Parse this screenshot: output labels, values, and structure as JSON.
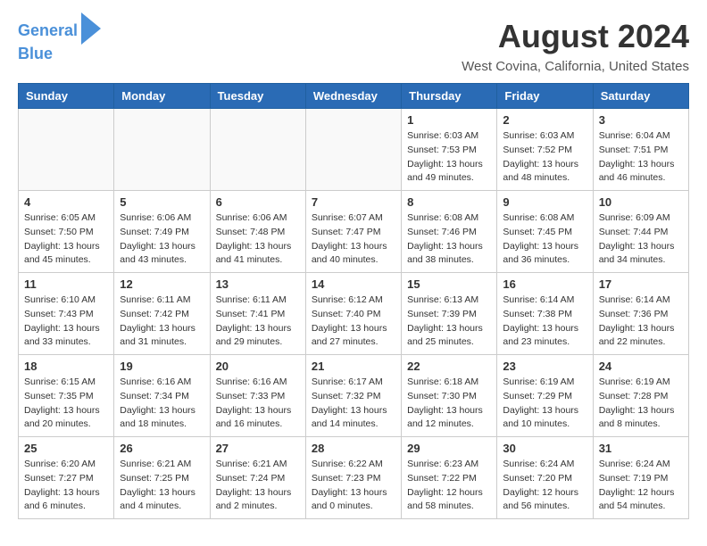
{
  "logo": {
    "line1": "General",
    "line2": "Blue"
  },
  "title": "August 2024",
  "subtitle": "West Covina, California, United States",
  "weekdays": [
    "Sunday",
    "Monday",
    "Tuesday",
    "Wednesday",
    "Thursday",
    "Friday",
    "Saturday"
  ],
  "weeks": [
    [
      {
        "day": "",
        "info": ""
      },
      {
        "day": "",
        "info": ""
      },
      {
        "day": "",
        "info": ""
      },
      {
        "day": "",
        "info": ""
      },
      {
        "day": "1",
        "info": "Sunrise: 6:03 AM\nSunset: 7:53 PM\nDaylight: 13 hours and 49 minutes."
      },
      {
        "day": "2",
        "info": "Sunrise: 6:03 AM\nSunset: 7:52 PM\nDaylight: 13 hours and 48 minutes."
      },
      {
        "day": "3",
        "info": "Sunrise: 6:04 AM\nSunset: 7:51 PM\nDaylight: 13 hours and 46 minutes."
      }
    ],
    [
      {
        "day": "4",
        "info": "Sunrise: 6:05 AM\nSunset: 7:50 PM\nDaylight: 13 hours and 45 minutes."
      },
      {
        "day": "5",
        "info": "Sunrise: 6:06 AM\nSunset: 7:49 PM\nDaylight: 13 hours and 43 minutes."
      },
      {
        "day": "6",
        "info": "Sunrise: 6:06 AM\nSunset: 7:48 PM\nDaylight: 13 hours and 41 minutes."
      },
      {
        "day": "7",
        "info": "Sunrise: 6:07 AM\nSunset: 7:47 PM\nDaylight: 13 hours and 40 minutes."
      },
      {
        "day": "8",
        "info": "Sunrise: 6:08 AM\nSunset: 7:46 PM\nDaylight: 13 hours and 38 minutes."
      },
      {
        "day": "9",
        "info": "Sunrise: 6:08 AM\nSunset: 7:45 PM\nDaylight: 13 hours and 36 minutes."
      },
      {
        "day": "10",
        "info": "Sunrise: 6:09 AM\nSunset: 7:44 PM\nDaylight: 13 hours and 34 minutes."
      }
    ],
    [
      {
        "day": "11",
        "info": "Sunrise: 6:10 AM\nSunset: 7:43 PM\nDaylight: 13 hours and 33 minutes."
      },
      {
        "day": "12",
        "info": "Sunrise: 6:11 AM\nSunset: 7:42 PM\nDaylight: 13 hours and 31 minutes."
      },
      {
        "day": "13",
        "info": "Sunrise: 6:11 AM\nSunset: 7:41 PM\nDaylight: 13 hours and 29 minutes."
      },
      {
        "day": "14",
        "info": "Sunrise: 6:12 AM\nSunset: 7:40 PM\nDaylight: 13 hours and 27 minutes."
      },
      {
        "day": "15",
        "info": "Sunrise: 6:13 AM\nSunset: 7:39 PM\nDaylight: 13 hours and 25 minutes."
      },
      {
        "day": "16",
        "info": "Sunrise: 6:14 AM\nSunset: 7:38 PM\nDaylight: 13 hours and 23 minutes."
      },
      {
        "day": "17",
        "info": "Sunrise: 6:14 AM\nSunset: 7:36 PM\nDaylight: 13 hours and 22 minutes."
      }
    ],
    [
      {
        "day": "18",
        "info": "Sunrise: 6:15 AM\nSunset: 7:35 PM\nDaylight: 13 hours and 20 minutes."
      },
      {
        "day": "19",
        "info": "Sunrise: 6:16 AM\nSunset: 7:34 PM\nDaylight: 13 hours and 18 minutes."
      },
      {
        "day": "20",
        "info": "Sunrise: 6:16 AM\nSunset: 7:33 PM\nDaylight: 13 hours and 16 minutes."
      },
      {
        "day": "21",
        "info": "Sunrise: 6:17 AM\nSunset: 7:32 PM\nDaylight: 13 hours and 14 minutes."
      },
      {
        "day": "22",
        "info": "Sunrise: 6:18 AM\nSunset: 7:30 PM\nDaylight: 13 hours and 12 minutes."
      },
      {
        "day": "23",
        "info": "Sunrise: 6:19 AM\nSunset: 7:29 PM\nDaylight: 13 hours and 10 minutes."
      },
      {
        "day": "24",
        "info": "Sunrise: 6:19 AM\nSunset: 7:28 PM\nDaylight: 13 hours and 8 minutes."
      }
    ],
    [
      {
        "day": "25",
        "info": "Sunrise: 6:20 AM\nSunset: 7:27 PM\nDaylight: 13 hours and 6 minutes."
      },
      {
        "day": "26",
        "info": "Sunrise: 6:21 AM\nSunset: 7:25 PM\nDaylight: 13 hours and 4 minutes."
      },
      {
        "day": "27",
        "info": "Sunrise: 6:21 AM\nSunset: 7:24 PM\nDaylight: 13 hours and 2 minutes."
      },
      {
        "day": "28",
        "info": "Sunrise: 6:22 AM\nSunset: 7:23 PM\nDaylight: 13 hours and 0 minutes."
      },
      {
        "day": "29",
        "info": "Sunrise: 6:23 AM\nSunset: 7:22 PM\nDaylight: 12 hours and 58 minutes."
      },
      {
        "day": "30",
        "info": "Sunrise: 6:24 AM\nSunset: 7:20 PM\nDaylight: 12 hours and 56 minutes."
      },
      {
        "day": "31",
        "info": "Sunrise: 6:24 AM\nSunset: 7:19 PM\nDaylight: 12 hours and 54 minutes."
      }
    ]
  ]
}
